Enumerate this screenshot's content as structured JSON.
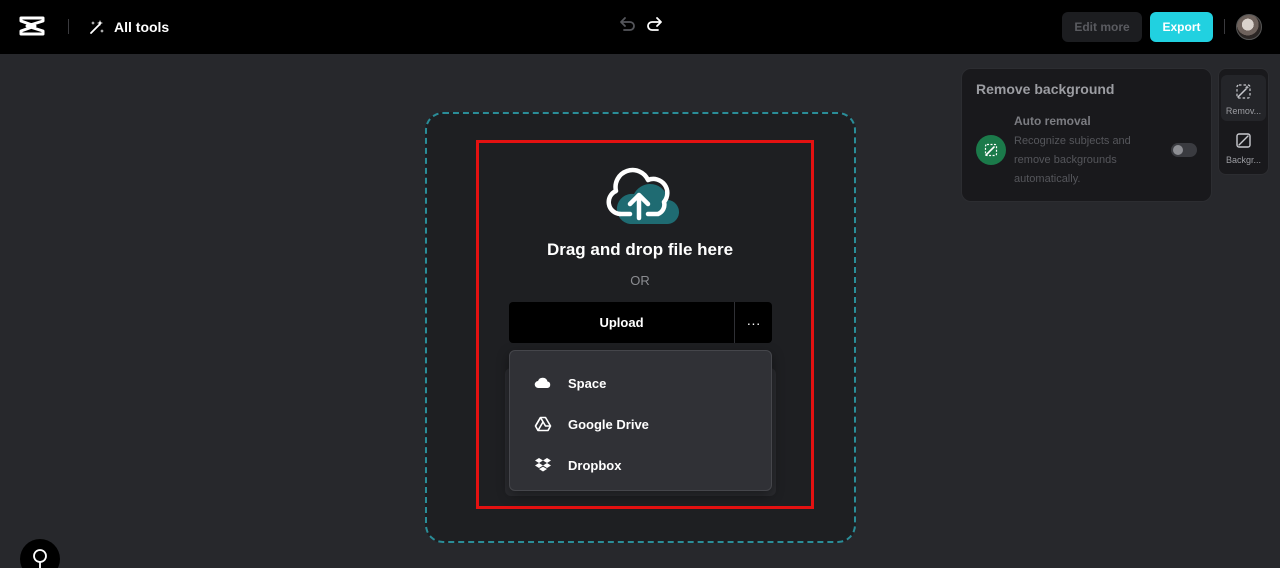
{
  "header": {
    "all_tools_label": "All tools",
    "edit_more_label": "Edit more",
    "export_label": "Export"
  },
  "upload": {
    "drag_text": "Drag and drop file here",
    "or_text": "OR",
    "upload_label": "Upload",
    "more_label": "···"
  },
  "dropdown": {
    "items": [
      {
        "label": "Space",
        "icon": "cloud-icon"
      },
      {
        "label": "Google Drive",
        "icon": "google-drive-icon"
      },
      {
        "label": "Dropbox",
        "icon": "dropbox-icon"
      }
    ]
  },
  "panel": {
    "title": "Remove background",
    "auto_removal_title": "Auto removal",
    "auto_removal_desc": "Recognize subjects and remove backgrounds automatically."
  },
  "sidetabs": [
    {
      "label": "Remov...",
      "icon": "magic-wand-icon"
    },
    {
      "label": "Backgr...",
      "icon": "background-icon"
    }
  ],
  "colors": {
    "accent": "#21d1e0",
    "dropzone_border": "#2a8d98",
    "highlight": "#e41111"
  }
}
